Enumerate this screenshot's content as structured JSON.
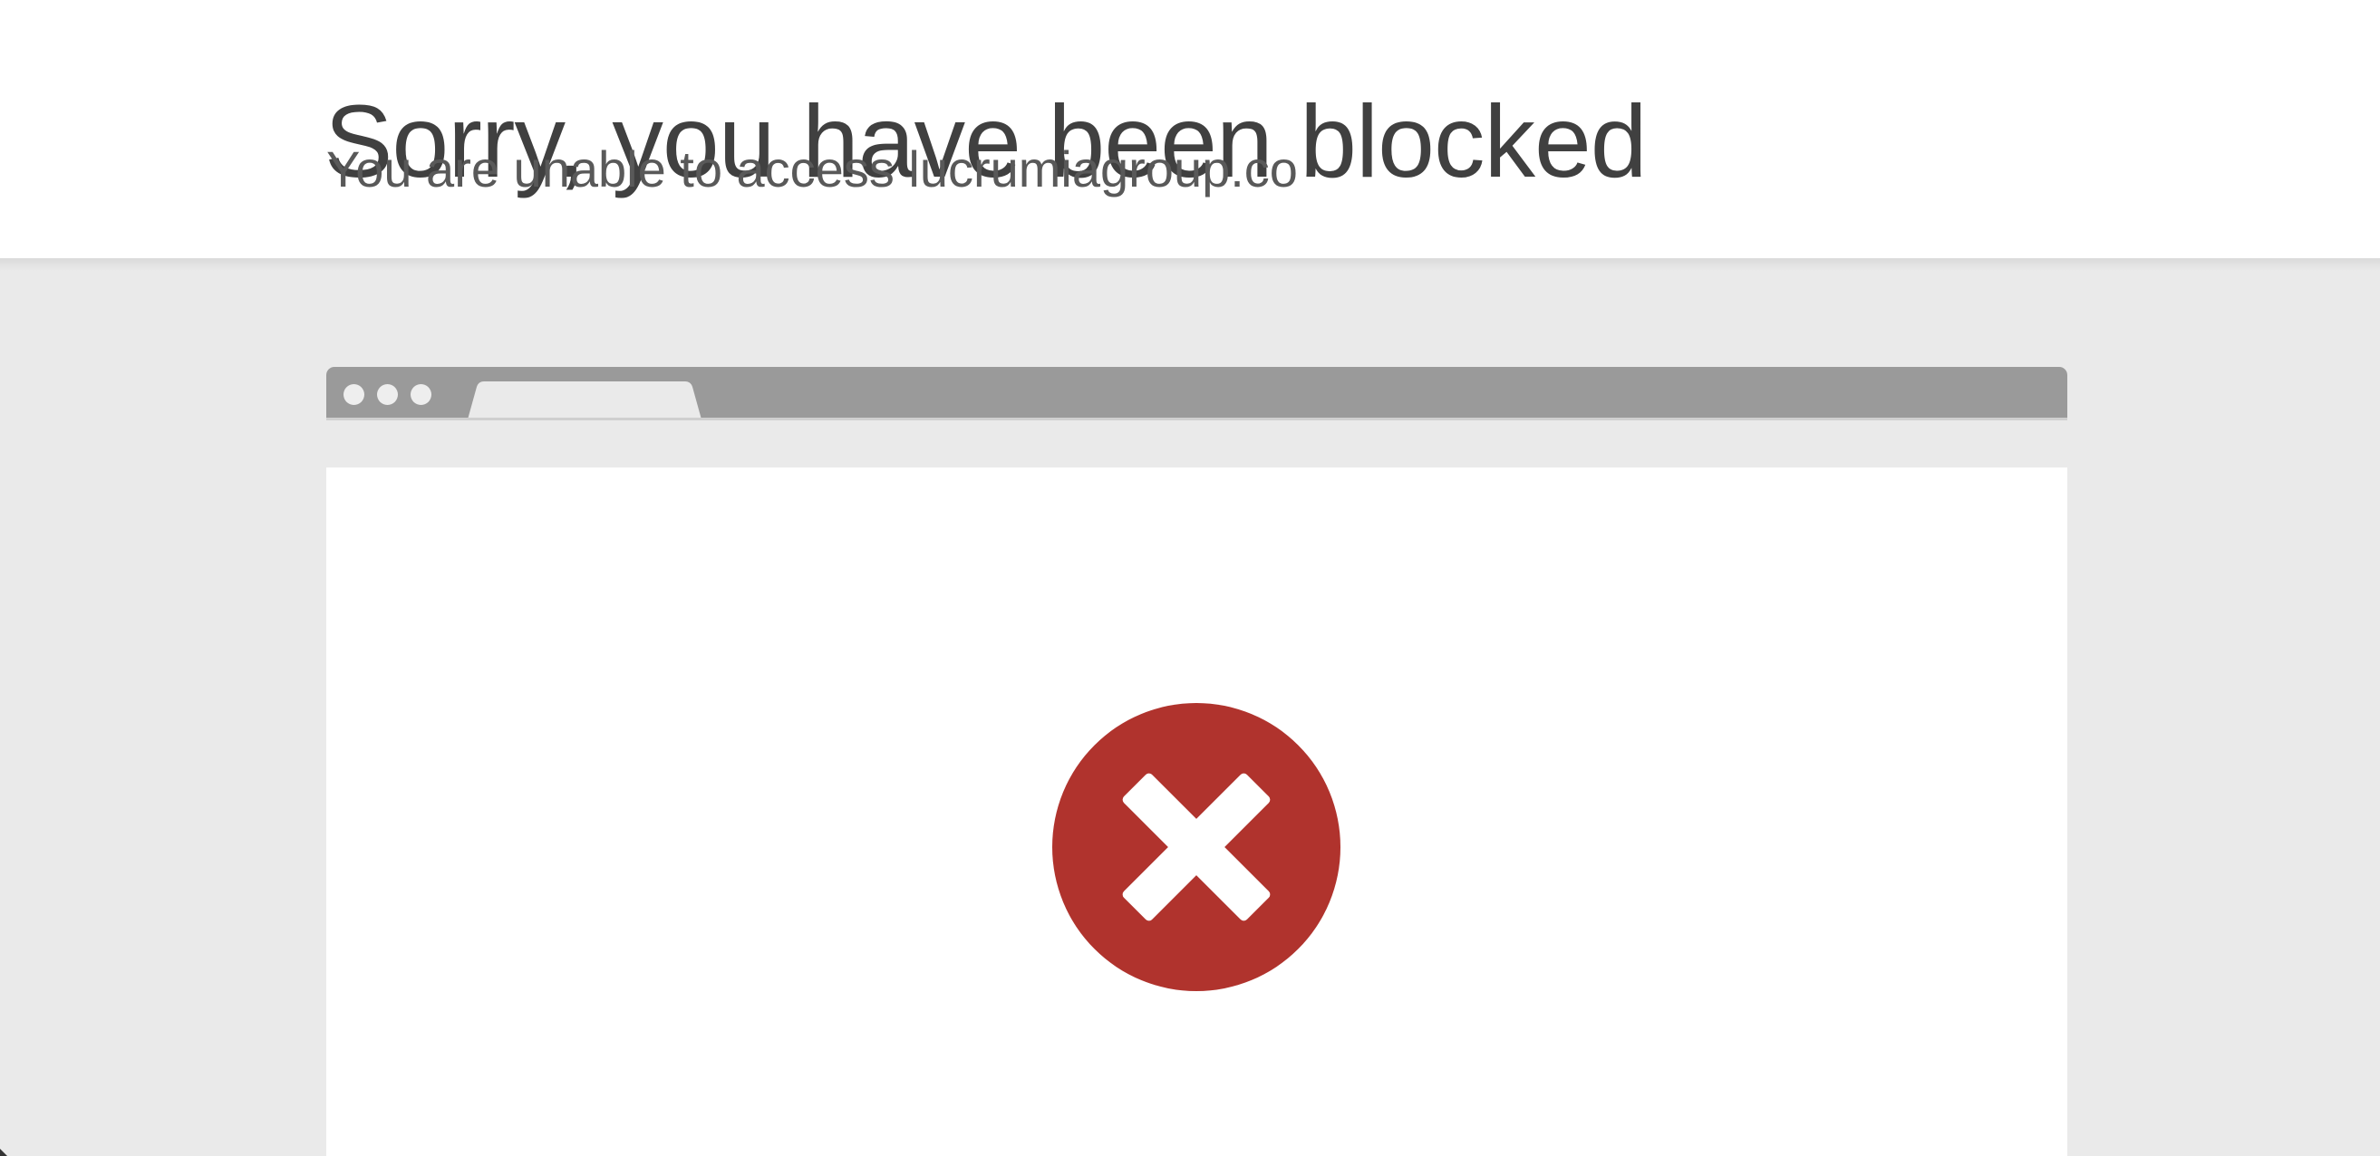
{
  "page": {
    "title": "Sorry, you have been blocked",
    "subtitle": "You are unable to access lucrumiagroup.co"
  },
  "icons": {
    "browser_dots": "window-control-dots-icon",
    "blocked": "blocked-x-icon"
  },
  "colors": {
    "title": "#404040",
    "subtitle": "#595959",
    "background_gray": "#eaeaea",
    "browser_bar": "#9a9a9a",
    "error_red": "#b0332d"
  }
}
